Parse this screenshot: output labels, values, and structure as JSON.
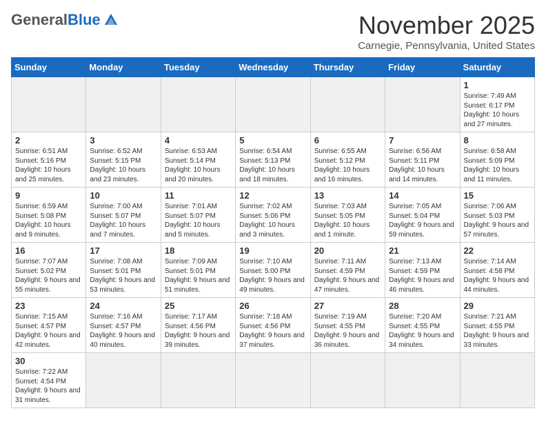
{
  "header": {
    "logo_general": "General",
    "logo_blue": "Blue",
    "title": "November 2025",
    "subtitle": "Carnegie, Pennsylvania, United States"
  },
  "weekdays": [
    "Sunday",
    "Monday",
    "Tuesday",
    "Wednesday",
    "Thursday",
    "Friday",
    "Saturday"
  ],
  "weeks": [
    [
      {
        "day": "",
        "empty": true
      },
      {
        "day": "",
        "empty": true
      },
      {
        "day": "",
        "empty": true
      },
      {
        "day": "",
        "empty": true
      },
      {
        "day": "",
        "empty": true
      },
      {
        "day": "",
        "empty": true
      },
      {
        "day": "1",
        "info": "Sunrise: 7:49 AM\nSunset: 6:17 PM\nDaylight: 10 hours and 27 minutes."
      }
    ],
    [
      {
        "day": "2",
        "info": "Sunrise: 6:51 AM\nSunset: 5:16 PM\nDaylight: 10 hours and 25 minutes."
      },
      {
        "day": "3",
        "info": "Sunrise: 6:52 AM\nSunset: 5:15 PM\nDaylight: 10 hours and 23 minutes."
      },
      {
        "day": "4",
        "info": "Sunrise: 6:53 AM\nSunset: 5:14 PM\nDaylight: 10 hours and 20 minutes."
      },
      {
        "day": "5",
        "info": "Sunrise: 6:54 AM\nSunset: 5:13 PM\nDaylight: 10 hours and 18 minutes."
      },
      {
        "day": "6",
        "info": "Sunrise: 6:55 AM\nSunset: 5:12 PM\nDaylight: 10 hours and 16 minutes."
      },
      {
        "day": "7",
        "info": "Sunrise: 6:56 AM\nSunset: 5:11 PM\nDaylight: 10 hours and 14 minutes."
      },
      {
        "day": "8",
        "info": "Sunrise: 6:58 AM\nSunset: 5:09 PM\nDaylight: 10 hours and 11 minutes."
      }
    ],
    [
      {
        "day": "9",
        "info": "Sunrise: 6:59 AM\nSunset: 5:08 PM\nDaylight: 10 hours and 9 minutes."
      },
      {
        "day": "10",
        "info": "Sunrise: 7:00 AM\nSunset: 5:07 PM\nDaylight: 10 hours and 7 minutes."
      },
      {
        "day": "11",
        "info": "Sunrise: 7:01 AM\nSunset: 5:07 PM\nDaylight: 10 hours and 5 minutes."
      },
      {
        "day": "12",
        "info": "Sunrise: 7:02 AM\nSunset: 5:06 PM\nDaylight: 10 hours and 3 minutes."
      },
      {
        "day": "13",
        "info": "Sunrise: 7:03 AM\nSunset: 5:05 PM\nDaylight: 10 hours and 1 minute."
      },
      {
        "day": "14",
        "info": "Sunrise: 7:05 AM\nSunset: 5:04 PM\nDaylight: 9 hours and 59 minutes."
      },
      {
        "day": "15",
        "info": "Sunrise: 7:06 AM\nSunset: 5:03 PM\nDaylight: 9 hours and 57 minutes."
      }
    ],
    [
      {
        "day": "16",
        "info": "Sunrise: 7:07 AM\nSunset: 5:02 PM\nDaylight: 9 hours and 55 minutes."
      },
      {
        "day": "17",
        "info": "Sunrise: 7:08 AM\nSunset: 5:01 PM\nDaylight: 9 hours and 53 minutes."
      },
      {
        "day": "18",
        "info": "Sunrise: 7:09 AM\nSunset: 5:01 PM\nDaylight: 9 hours and 51 minutes."
      },
      {
        "day": "19",
        "info": "Sunrise: 7:10 AM\nSunset: 5:00 PM\nDaylight: 9 hours and 49 minutes."
      },
      {
        "day": "20",
        "info": "Sunrise: 7:11 AM\nSunset: 4:59 PM\nDaylight: 9 hours and 47 minutes."
      },
      {
        "day": "21",
        "info": "Sunrise: 7:13 AM\nSunset: 4:59 PM\nDaylight: 9 hours and 46 minutes."
      },
      {
        "day": "22",
        "info": "Sunrise: 7:14 AM\nSunset: 4:58 PM\nDaylight: 9 hours and 44 minutes."
      }
    ],
    [
      {
        "day": "23",
        "info": "Sunrise: 7:15 AM\nSunset: 4:57 PM\nDaylight: 9 hours and 42 minutes."
      },
      {
        "day": "24",
        "info": "Sunrise: 7:16 AM\nSunset: 4:57 PM\nDaylight: 9 hours and 40 minutes."
      },
      {
        "day": "25",
        "info": "Sunrise: 7:17 AM\nSunset: 4:56 PM\nDaylight: 9 hours and 39 minutes."
      },
      {
        "day": "26",
        "info": "Sunrise: 7:18 AM\nSunset: 4:56 PM\nDaylight: 9 hours and 37 minutes."
      },
      {
        "day": "27",
        "info": "Sunrise: 7:19 AM\nSunset: 4:55 PM\nDaylight: 9 hours and 36 minutes."
      },
      {
        "day": "28",
        "info": "Sunrise: 7:20 AM\nSunset: 4:55 PM\nDaylight: 9 hours and 34 minutes."
      },
      {
        "day": "29",
        "info": "Sunrise: 7:21 AM\nSunset: 4:55 PM\nDaylight: 9 hours and 33 minutes."
      }
    ],
    [
      {
        "day": "30",
        "info": "Sunrise: 7:22 AM\nSunset: 4:54 PM\nDaylight: 9 hours and 31 minutes."
      },
      {
        "day": "",
        "empty": true
      },
      {
        "day": "",
        "empty": true
      },
      {
        "day": "",
        "empty": true
      },
      {
        "day": "",
        "empty": true
      },
      {
        "day": "",
        "empty": true
      },
      {
        "day": "",
        "empty": true
      }
    ]
  ]
}
